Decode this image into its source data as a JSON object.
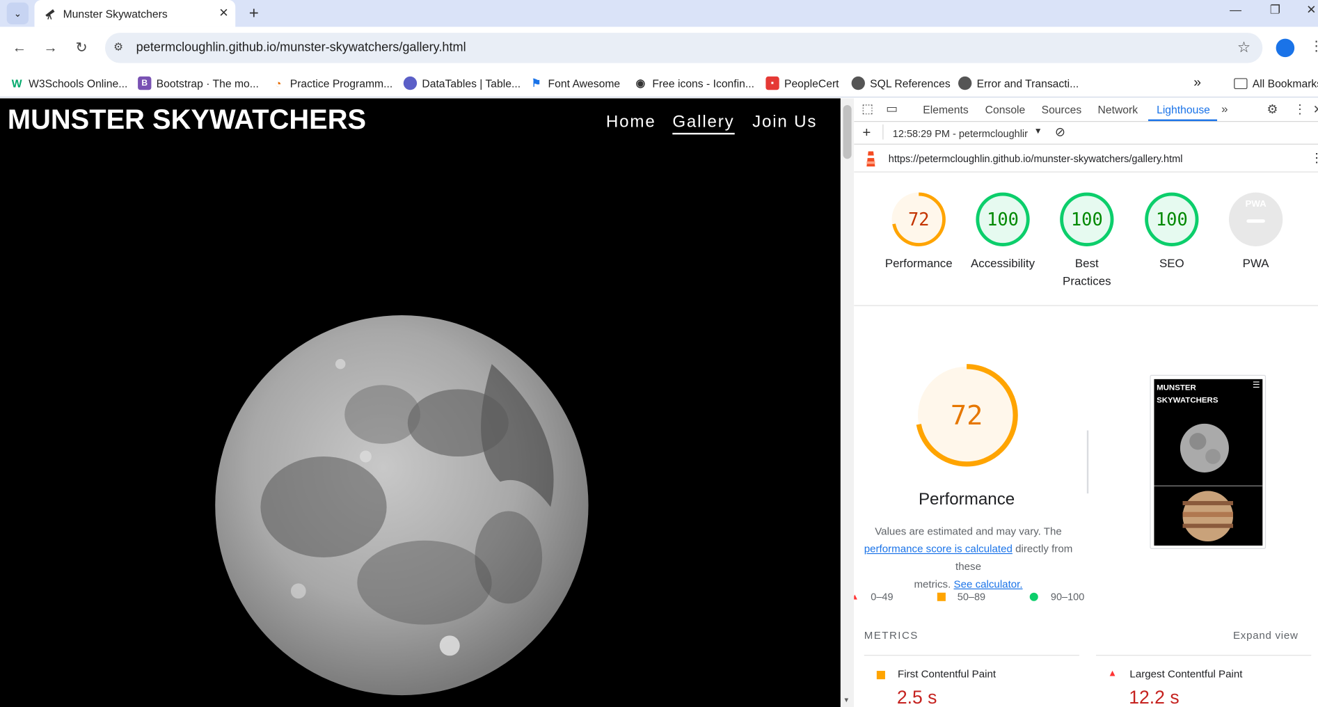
{
  "browser": {
    "tab_title": "Munster Skywatchers",
    "url": "petermcloughlin.github.io/munster-skywatchers/gallery.html",
    "bookmarks": [
      {
        "label": "W3Schools Online...",
        "icon": "w3schools-icon",
        "color": "#04aa6d"
      },
      {
        "label": "Bootstrap · The mo...",
        "icon": "bootstrap-icon",
        "color": "#7952b3"
      },
      {
        "label": "Practice Programm...",
        "icon": "practice-icon",
        "color": "#e8710a"
      },
      {
        "label": "DataTables | Table...",
        "icon": "datatables-icon",
        "color": "#5b5fc7"
      },
      {
        "label": "Font Awesome",
        "icon": "flag-icon",
        "color": "#1a73e8"
      },
      {
        "label": "Free icons - Iconfin...",
        "icon": "iconfinder-icon",
        "color": "#333333"
      },
      {
        "label": "PeopleCert",
        "icon": "peoplecert-icon",
        "color": "#e53935"
      },
      {
        "label": "SQL References",
        "icon": "globe-icon",
        "color": "#555555"
      },
      {
        "label": "Error and Transacti...",
        "icon": "globe-icon",
        "color": "#555555"
      }
    ],
    "all_bookmarks": "All Bookmarks"
  },
  "site": {
    "logo": "MUNSTER SKYWATCHERS",
    "nav": {
      "home": "Home",
      "gallery": "Gallery",
      "join": "Join Us"
    }
  },
  "devtools": {
    "tabs": {
      "elements": "Elements",
      "console": "Console",
      "sources": "Sources",
      "network": "Network",
      "lighthouse": "Lighthouse"
    },
    "report_time": "12:58:29 PM - petermcloughlir",
    "report_url": "https://petermcloughlin.github.io/munster-skywatchers/gallery.html",
    "gauges": [
      {
        "score": "72",
        "label": "Performance",
        "value": 0.72,
        "color": "#ffa400"
      },
      {
        "score": "100",
        "label": "Accessibility",
        "value": 1.0,
        "color": "#0cce6b"
      },
      {
        "score": "100",
        "label": "Best Practices",
        "value": 1.0,
        "color": "#0cce6b"
      },
      {
        "score": "100",
        "label": "SEO",
        "value": 1.0,
        "color": "#0cce6b"
      },
      {
        "score": "",
        "label": "PWA",
        "value": 0,
        "color": "#cccccc"
      }
    ],
    "pwa_badge": "PWA",
    "performance": {
      "score": "72",
      "value": 0.72,
      "title": "Performance",
      "desc_1": "Values are estimated and may vary. The",
      "desc_link": "performance score is calculated",
      "desc_2": " directly from these",
      "desc_3": "metrics. ",
      "desc_link2": "See calculator."
    },
    "legend": {
      "fail": "0–49",
      "average": "50–89",
      "pass": "90–100"
    },
    "metrics_heading": "METRICS",
    "expand_view": "Expand view",
    "metrics": [
      {
        "label": "First Contentful Paint",
        "value": "2.5 s",
        "status": "average"
      },
      {
        "label": "Largest Contentful Paint",
        "value": "12.2 s",
        "status": "fail"
      }
    ],
    "thumbnail_logo": "MUNSTER SKYWATCHERS"
  }
}
